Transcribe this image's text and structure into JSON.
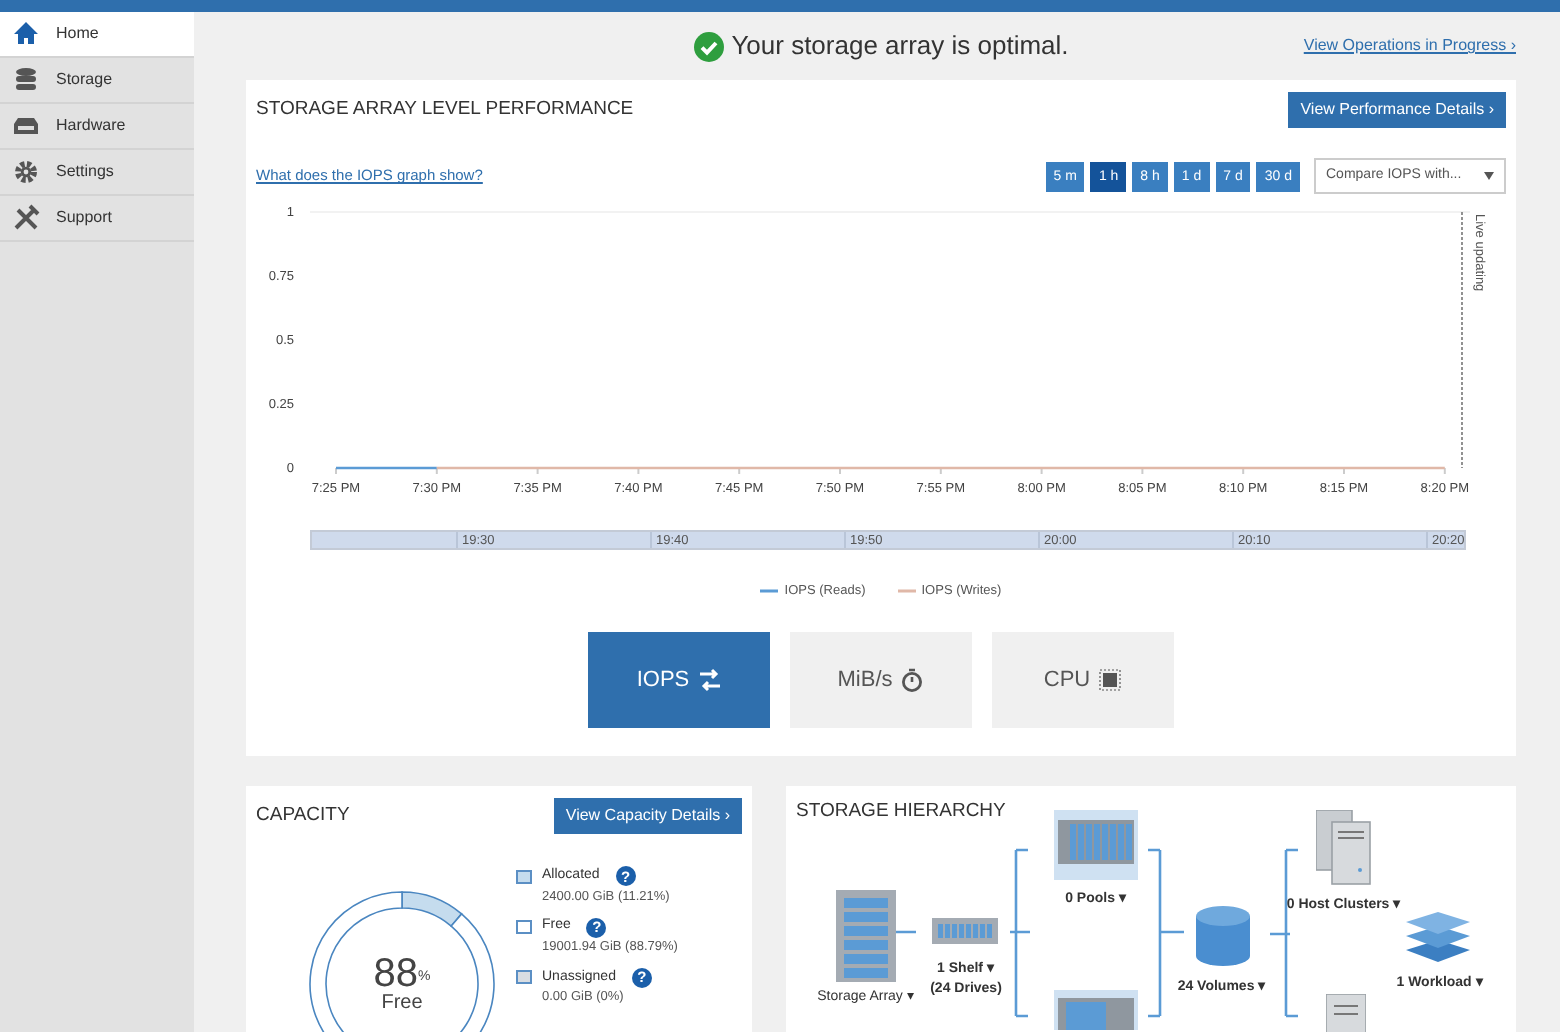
{
  "sidebar": {
    "items": [
      {
        "label": "Home",
        "selected": true
      },
      {
        "label": "Storage",
        "selected": false
      },
      {
        "label": "Hardware",
        "selected": false
      },
      {
        "label": "Settings",
        "selected": false
      },
      {
        "label": "Support",
        "selected": false
      }
    ]
  },
  "status": {
    "message": "Your storage array is optimal.",
    "link": "View Operations in Progress ›"
  },
  "performance": {
    "title": "STORAGE ARRAY LEVEL PERFORMANCE",
    "button": "View Performance Details ›",
    "help_link": "What does the IOPS graph show?",
    "ranges": [
      {
        "label": "5 m",
        "selected": false
      },
      {
        "label": "1 h",
        "selected": true
      },
      {
        "label": "8 h",
        "selected": false
      },
      {
        "label": "1 d",
        "selected": false
      },
      {
        "label": "7 d",
        "selected": false
      },
      {
        "label": "30 d",
        "selected": false
      }
    ],
    "compare": "Compare IOPS with...",
    "chart_data": {
      "type": "line",
      "categories": [
        "7:25 PM",
        "7:30 PM",
        "7:35 PM",
        "7:40 PM",
        "7:45 PM",
        "7:50 PM",
        "7:55 PM",
        "8:00 PM",
        "8:05 PM",
        "8:10 PM",
        "8:15 PM",
        "8:20 PM"
      ],
      "yticks": [
        0,
        0.25,
        0.5,
        0.75,
        1
      ],
      "ylim": [
        0,
        1
      ],
      "series": [
        {
          "name": "IOPS (Reads)",
          "color": "#5b9bd5",
          "values": [
            0,
            0,
            null,
            null,
            null,
            null,
            null,
            null,
            null,
            null,
            null,
            null
          ]
        },
        {
          "name": "IOPS (Writes)",
          "color": "#e0b8a8",
          "values": [
            null,
            0,
            0,
            0,
            0,
            0,
            0,
            0,
            0,
            0,
            0,
            0
          ]
        }
      ]
    },
    "live_label": "Live updating",
    "navigator": [
      "19:30",
      "19:40",
      "19:50",
      "20:00",
      "20:10",
      "20:20"
    ],
    "metrics": [
      {
        "label": "IOPS",
        "selected": true
      },
      {
        "label": "MiB/s",
        "selected": false
      },
      {
        "label": "CPU",
        "selected": false
      }
    ]
  },
  "capacity": {
    "title": "CAPACITY",
    "button": "View Capacity Details ›",
    "chart_data": {
      "type": "donut",
      "values": [
        11.21,
        88.79
      ]
    },
    "center": {
      "value": "88",
      "unit": "%",
      "label": "Free"
    },
    "legend": [
      {
        "label": "Allocated",
        "detail": "2400.00 GiB (11.21%)",
        "color": "#c5dcee",
        "help": "?"
      },
      {
        "label": "Free",
        "detail": "19001.94 GiB (88.79%)",
        "color": "#ffffff",
        "help": "?"
      },
      {
        "label": "Unassigned",
        "detail": "0.00 GiB (0%)",
        "color": "#d9dde2",
        "help": "?"
      }
    ]
  },
  "hierarchy": {
    "title": "STORAGE HIERARCHY",
    "nodes": [
      {
        "kind": "array",
        "label": "Storage Array ▾"
      },
      {
        "kind": "shelf",
        "label": "1 Shelf ▾",
        "sublabel": "(24 Drives)"
      },
      {
        "kind": "pools",
        "label": "0 Pools ▾"
      },
      {
        "kind": "volumes",
        "label": "24 Volumes ▾"
      },
      {
        "kind": "hosts",
        "label": "0 Host Clusters ▾"
      },
      {
        "kind": "workload",
        "label": "1 Workload ▾"
      }
    ]
  }
}
